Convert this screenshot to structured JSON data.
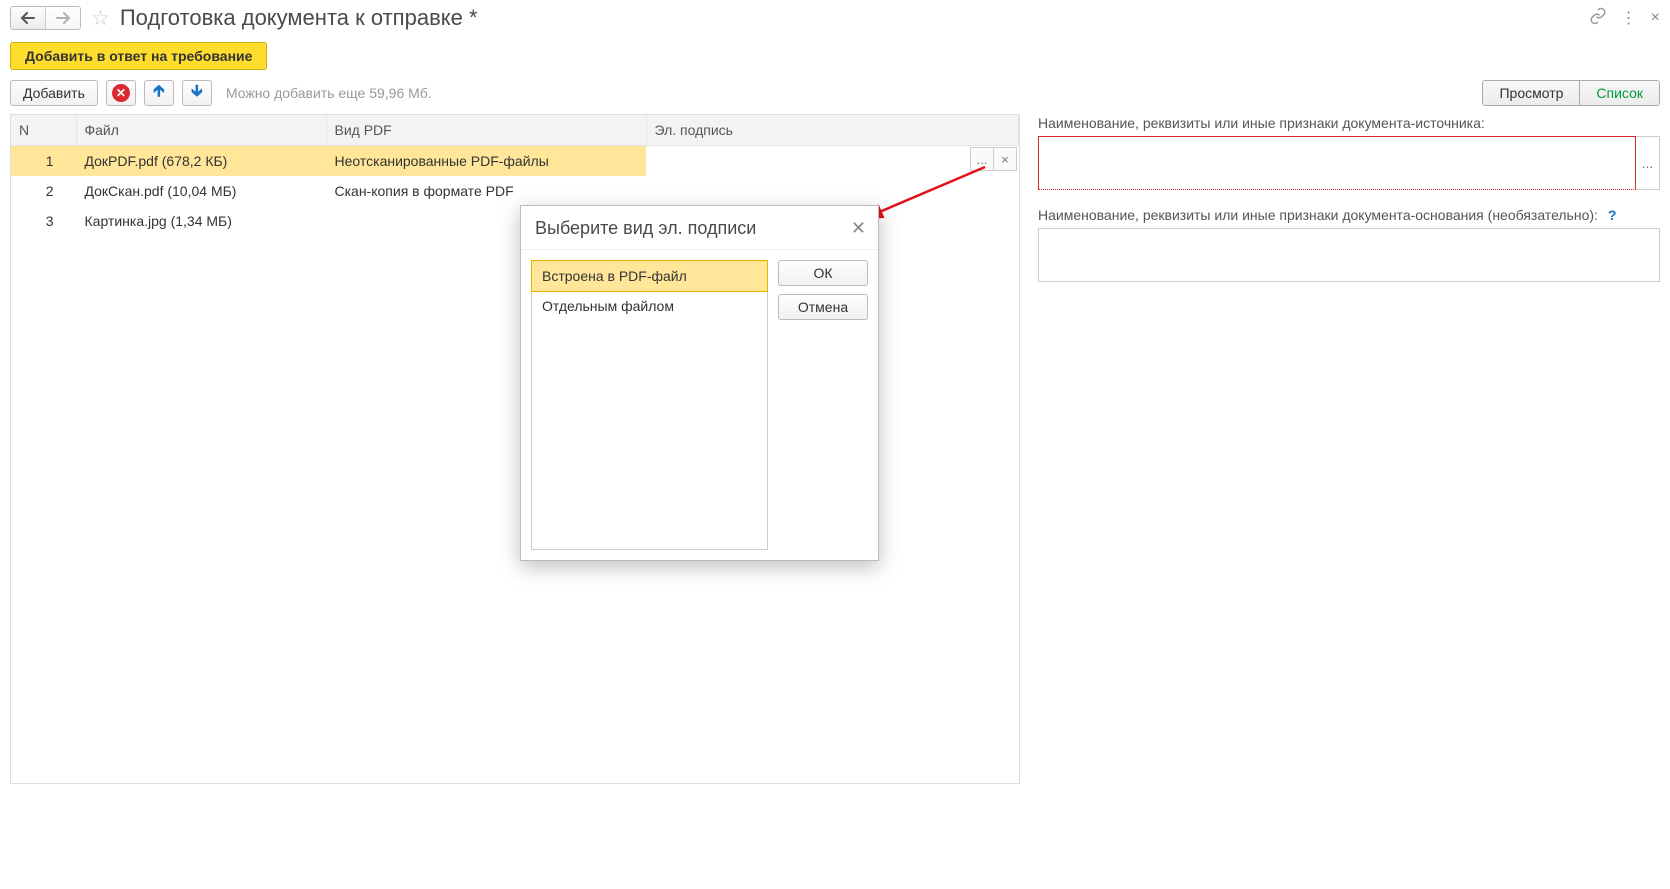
{
  "window": {
    "title": "Подготовка документа к отправке *"
  },
  "toolbar": {
    "add_to_response": "Добавить в ответ на требование",
    "add": "Добавить",
    "hint": "Можно добавить еще 59,96 Мб.",
    "view": "Просмотр",
    "list": "Список"
  },
  "table": {
    "headers": {
      "n": "N",
      "file": "Файл",
      "pdf": "Вид PDF",
      "sig": "Эл. подпись"
    },
    "rows": [
      {
        "n": "1",
        "file": "ДокPDF.pdf (678,2 КБ)",
        "pdf": "Неотсканированные PDF-файлы",
        "sig": ""
      },
      {
        "n": "2",
        "file": "ДокСкан.pdf (10,04 МБ)",
        "pdf": "Скан-копия в формате PDF",
        "sig": ""
      },
      {
        "n": "3",
        "file": "Картинка.jpg (1,34 МБ)",
        "pdf": "",
        "sig": ""
      }
    ],
    "row_actions": {
      "more": "...",
      "clear": "×"
    }
  },
  "side": {
    "label1": "Наименование, реквизиты или иные признаки документа-источника:",
    "value1": "",
    "more": "...",
    "label2": "Наименование, реквизиты или иные признаки документа-основания (необязательно):",
    "value2": "",
    "help": "?"
  },
  "dialog": {
    "title": "Выберите вид эл. подписи",
    "options": [
      "Встроена в PDF-файл",
      "Отдельным файлом"
    ],
    "ok": "ОК",
    "cancel": "Отмена"
  }
}
